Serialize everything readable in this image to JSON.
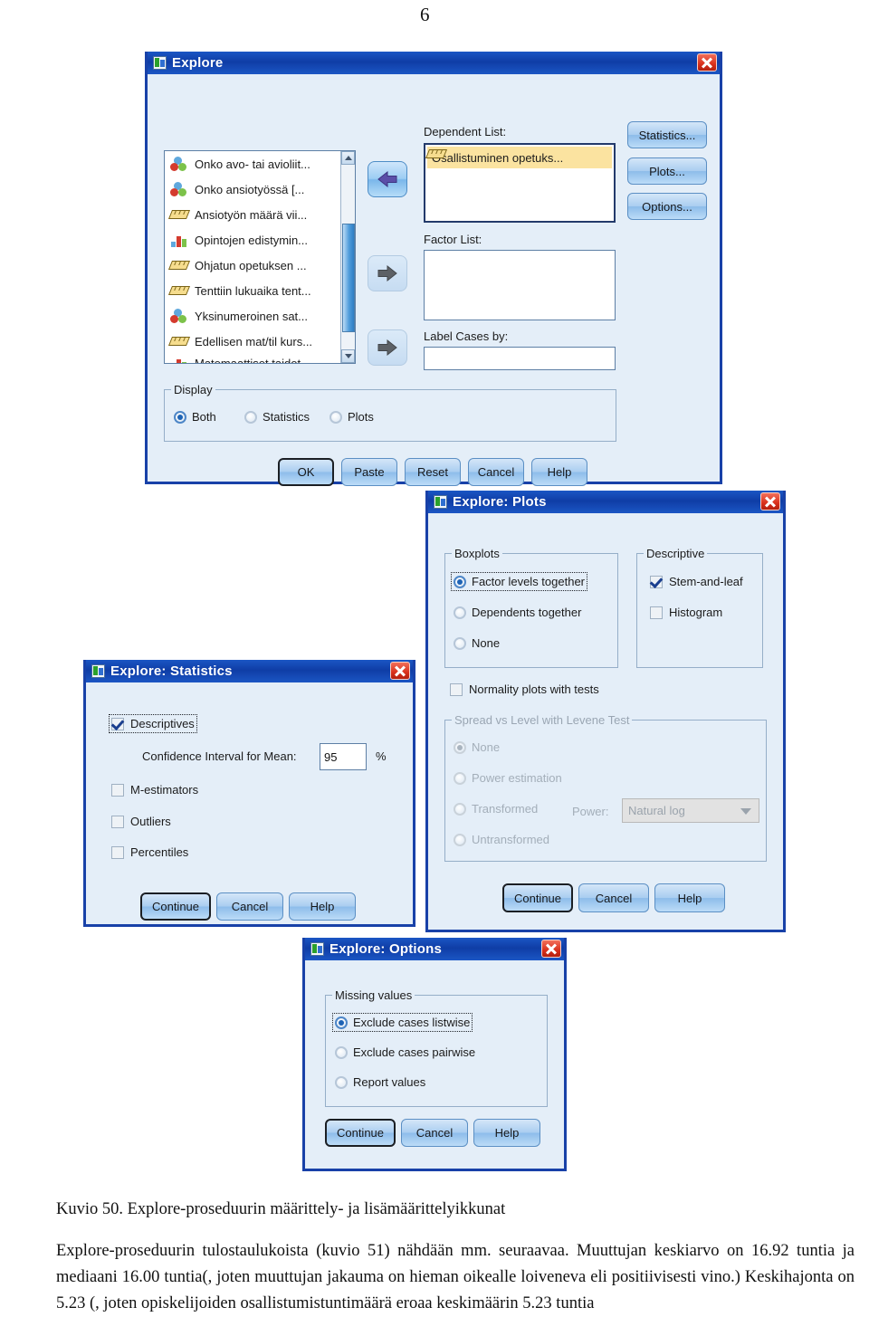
{
  "page": {
    "number": "6"
  },
  "explore_dialog": {
    "title": "Explore",
    "icon": "spss-window-icon",
    "close_label": "close-icon",
    "source_list": {
      "items": [
        {
          "label": "Onko avo- tai avioliit...",
          "measure_icon": "nominal-icon"
        },
        {
          "label": "Onko ansiotyössä [...",
          "measure_icon": "nominal-icon"
        },
        {
          "label": "Ansiotyön määrä vii...",
          "measure_icon": "scale-icon"
        },
        {
          "label": "Opintojen edistymin...",
          "measure_icon": "ordinal-icon"
        },
        {
          "label": "Ohjatun opetuksen ...",
          "measure_icon": "scale-icon"
        },
        {
          "label": "Tenttiin lukuaika tent...",
          "measure_icon": "scale-icon"
        },
        {
          "label": "Yksinumeroinen sat...",
          "measure_icon": "nominal-icon"
        },
        {
          "label": "Edellisen mat/til kurs...",
          "measure_icon": "scale-icon"
        },
        {
          "label": "Matemaattiset taidot",
          "measure_icon": "ordinal-icon"
        }
      ]
    },
    "dependent_list": {
      "label": "Dependent List:",
      "items": [
        {
          "label": "Osallistuminen opetuks...",
          "measure_icon": "scale-icon",
          "selected": true
        }
      ]
    },
    "factor_list": {
      "label": "Factor List:",
      "items": []
    },
    "label_cases_by": {
      "label": "Label Cases by:",
      "value": ""
    },
    "side_buttons": [
      {
        "label": "Statistics...",
        "name": "statistics-button"
      },
      {
        "label": "Plots...",
        "name": "plots-button"
      },
      {
        "label": "Options...",
        "name": "options-button"
      }
    ],
    "transfer_buttons": [
      {
        "name": "move-to-dependent-list-button",
        "direction": "left",
        "state": "active"
      },
      {
        "name": "move-to-factor-list-button",
        "direction": "right",
        "state": "idle"
      },
      {
        "name": "move-to-label-cases-button",
        "direction": "right",
        "state": "idle"
      }
    ],
    "display_group": {
      "title": "Display",
      "options": [
        {
          "label": "Both",
          "mnemonic": "B",
          "selected": true
        },
        {
          "label": "Statistics",
          "mnemonic": "a",
          "selected": false
        },
        {
          "label": "Plots",
          "mnemonic": "o",
          "selected": false
        }
      ]
    },
    "action_buttons": [
      {
        "label": "OK",
        "name": "ok-button",
        "default": true
      },
      {
        "label": "Paste",
        "name": "paste-button",
        "default": false
      },
      {
        "label": "Reset",
        "name": "reset-button",
        "default": false
      },
      {
        "label": "Cancel",
        "name": "cancel-button",
        "default": false
      },
      {
        "label": "Help",
        "name": "help-button",
        "default": false
      }
    ]
  },
  "plots_dialog": {
    "title": "Explore: Plots",
    "boxplots_group": {
      "title": "Boxplots",
      "options": [
        {
          "label": "Factor levels together",
          "selected": true,
          "focused": true
        },
        {
          "label": "Dependents together",
          "selected": false,
          "focused": false
        },
        {
          "label": "None",
          "selected": false,
          "focused": false
        }
      ]
    },
    "descriptive_group": {
      "title": "Descriptive",
      "options": [
        {
          "label": "Stem-and-leaf",
          "checked": true
        },
        {
          "label": "Histogram",
          "checked": false
        }
      ]
    },
    "normality_checkbox": {
      "label": "Normality plots with tests",
      "checked": false
    },
    "spread_group": {
      "title": "Spread vs Level with Levene Test",
      "disabled": true,
      "options": [
        {
          "label": "None",
          "selected": true
        },
        {
          "label": "Power estimation",
          "selected": false
        },
        {
          "label": "Transformed",
          "selected": false
        },
        {
          "label": "Untransformed",
          "selected": false
        }
      ],
      "power_label": "Power:",
      "power_value": "Natural log"
    },
    "action_buttons": [
      {
        "label": "Continue",
        "name": "continue-button",
        "default": true
      },
      {
        "label": "Cancel",
        "name": "cancel-button",
        "default": false
      },
      {
        "label": "Help",
        "name": "help-button",
        "default": false
      }
    ]
  },
  "statistics_dialog": {
    "title": "Explore: Statistics",
    "options": [
      {
        "label": "Descriptives",
        "checked": true,
        "focused": true
      },
      {
        "label": "M-estimators",
        "checked": false,
        "focused": false
      },
      {
        "label": "Outliers",
        "checked": false,
        "focused": false
      },
      {
        "label": "Percentiles",
        "checked": false,
        "focused": false
      }
    ],
    "confidence_interval": {
      "label": "Confidence Interval for Mean:",
      "value": "95",
      "unit": "%"
    },
    "action_buttons": [
      {
        "label": "Continue",
        "name": "continue-button",
        "default": true
      },
      {
        "label": "Cancel",
        "name": "cancel-button",
        "default": false
      },
      {
        "label": "Help",
        "name": "help-button",
        "default": false
      }
    ]
  },
  "options_dialog": {
    "title": "Explore: Options",
    "missing_values_group": {
      "title": "Missing values",
      "options": [
        {
          "label": "Exclude cases listwise",
          "selected": true,
          "focused": true
        },
        {
          "label": "Exclude cases pairwise",
          "selected": false,
          "focused": false
        },
        {
          "label": "Report values",
          "selected": false,
          "focused": false
        }
      ]
    },
    "action_buttons": [
      {
        "label": "Continue",
        "name": "continue-button",
        "default": true
      },
      {
        "label": "Cancel",
        "name": "cancel-button",
        "default": false
      },
      {
        "label": "Help",
        "name": "help-button",
        "default": false
      }
    ]
  },
  "document": {
    "figure_caption": "Kuvio 50. Explore-proseduurin määrittely- ja lisämäärittelyikkunat",
    "paragraph": "Explore-proseduurin tulostaulukoista (kuvio 51) nähdään mm. seuraavaa. Muuttujan keskiarvo on 16.92 tuntia ja mediaani 16.00 tuntia(, joten muuttujan jakauma on hieman oikealle loiveneva eli positiivisesti vino.) Keskihajonta on 5.23 (, joten opiskelijoiden osallistumistuntimäärä eroaa keskimäärin 5.23 tuntia"
  }
}
